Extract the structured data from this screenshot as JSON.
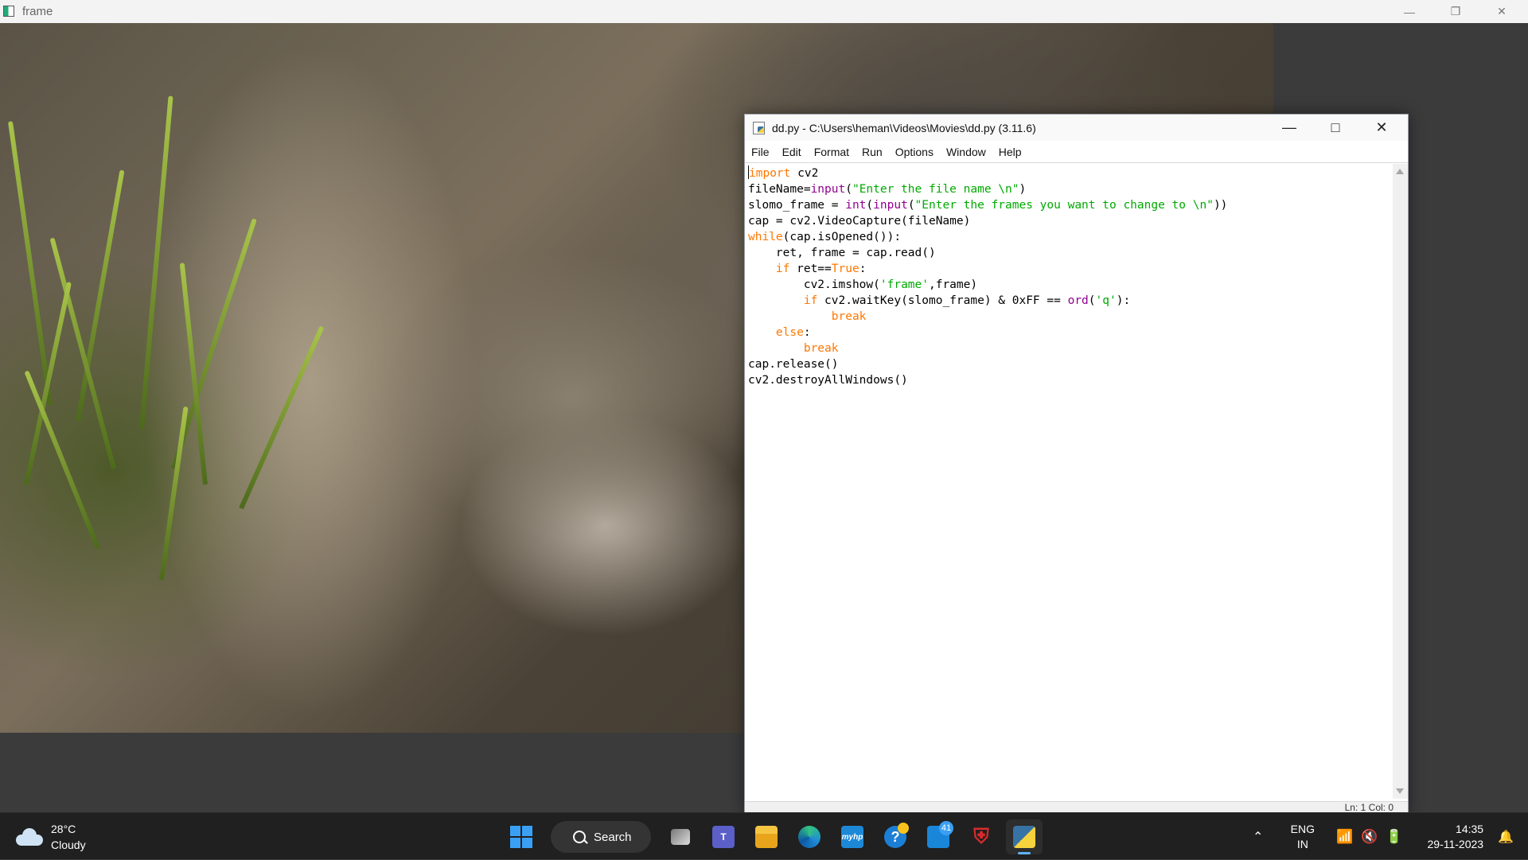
{
  "frame_window": {
    "title": "frame"
  },
  "idle_window": {
    "title": "dd.py - C:\\Users\\heman\\Videos\\Movies\\dd.py (3.11.6)",
    "menu": [
      "File",
      "Edit",
      "Format",
      "Run",
      "Options",
      "Window",
      "Help"
    ],
    "status": "Ln: 1   Col: 0"
  },
  "code": [
    [
      {
        "t": "import",
        "c": "kw"
      },
      {
        "t": " cv2",
        "c": ""
      }
    ],
    [
      {
        "t": "fileName=",
        "c": ""
      },
      {
        "t": "input",
        "c": "bi"
      },
      {
        "t": "(",
        "c": ""
      },
      {
        "t": "\"Enter the file name \\n\"",
        "c": "str"
      },
      {
        "t": ")",
        "c": ""
      }
    ],
    [
      {
        "t": "slomo_frame = ",
        "c": ""
      },
      {
        "t": "int",
        "c": "bi"
      },
      {
        "t": "(",
        "c": ""
      },
      {
        "t": "input",
        "c": "bi"
      },
      {
        "t": "(",
        "c": ""
      },
      {
        "t": "\"Enter the frames you want to change to \\n\"",
        "c": "str"
      },
      {
        "t": "))",
        "c": ""
      }
    ],
    [
      {
        "t": "cap = cv2.VideoCapture(fileName)",
        "c": ""
      }
    ],
    [
      {
        "t": "while",
        "c": "kw"
      },
      {
        "t": "(cap.isOpened()):",
        "c": ""
      }
    ],
    [
      {
        "t": "    ret, frame = cap.read()",
        "c": ""
      }
    ],
    [
      {
        "t": "    ",
        "c": ""
      },
      {
        "t": "if",
        "c": "kw"
      },
      {
        "t": " ret==",
        "c": ""
      },
      {
        "t": "True",
        "c": "kw"
      },
      {
        "t": ":",
        "c": ""
      }
    ],
    [
      {
        "t": "        cv2.imshow(",
        "c": ""
      },
      {
        "t": "'frame'",
        "c": "str"
      },
      {
        "t": ",frame)",
        "c": ""
      }
    ],
    [
      {
        "t": "        ",
        "c": ""
      },
      {
        "t": "if",
        "c": "kw"
      },
      {
        "t": " cv2.waitKey(slomo_frame) & 0xFF == ",
        "c": ""
      },
      {
        "t": "ord",
        "c": "bi"
      },
      {
        "t": "(",
        "c": ""
      },
      {
        "t": "'q'",
        "c": "str"
      },
      {
        "t": "):",
        "c": ""
      }
    ],
    [
      {
        "t": "            ",
        "c": ""
      },
      {
        "t": "break",
        "c": "kw"
      }
    ],
    [
      {
        "t": "    ",
        "c": ""
      },
      {
        "t": "else",
        "c": "kw"
      },
      {
        "t": ":",
        "c": ""
      }
    ],
    [
      {
        "t": "        ",
        "c": ""
      },
      {
        "t": "break",
        "c": "kw"
      }
    ],
    [
      {
        "t": "cap.release()",
        "c": ""
      }
    ],
    [
      {
        "t": "cv2.destroyAllWindows()",
        "c": ""
      }
    ]
  ],
  "taskbar": {
    "weather_temp": "28°C",
    "weather_desc": "Cloudy",
    "search_label": "Search",
    "apps": [
      {
        "name": "task-view",
        "icon": "task-view-icon"
      },
      {
        "name": "teams",
        "icon": "teams-icon"
      },
      {
        "name": "file-explorer",
        "icon": "folder-icon"
      },
      {
        "name": "edge",
        "icon": "edge-icon"
      },
      {
        "name": "myhp",
        "icon": "myhp-icon",
        "label": "myhp"
      },
      {
        "name": "get-help",
        "icon": "help-icon"
      },
      {
        "name": "microsoft-store",
        "icon": "store-icon",
        "badge": "41"
      },
      {
        "name": "mcafee",
        "icon": "mcafee-icon"
      },
      {
        "name": "idle",
        "icon": "python-idle-icon"
      }
    ],
    "lang_top": "ENG",
    "lang_bottom": "IN",
    "time": "14:35",
    "date": "29-11-2023"
  },
  "colors": {
    "keyword": "#ff7700",
    "builtin": "#900090",
    "string": "#00aa00",
    "taskbar": "#202020",
    "accent": "#3aa0f5"
  }
}
